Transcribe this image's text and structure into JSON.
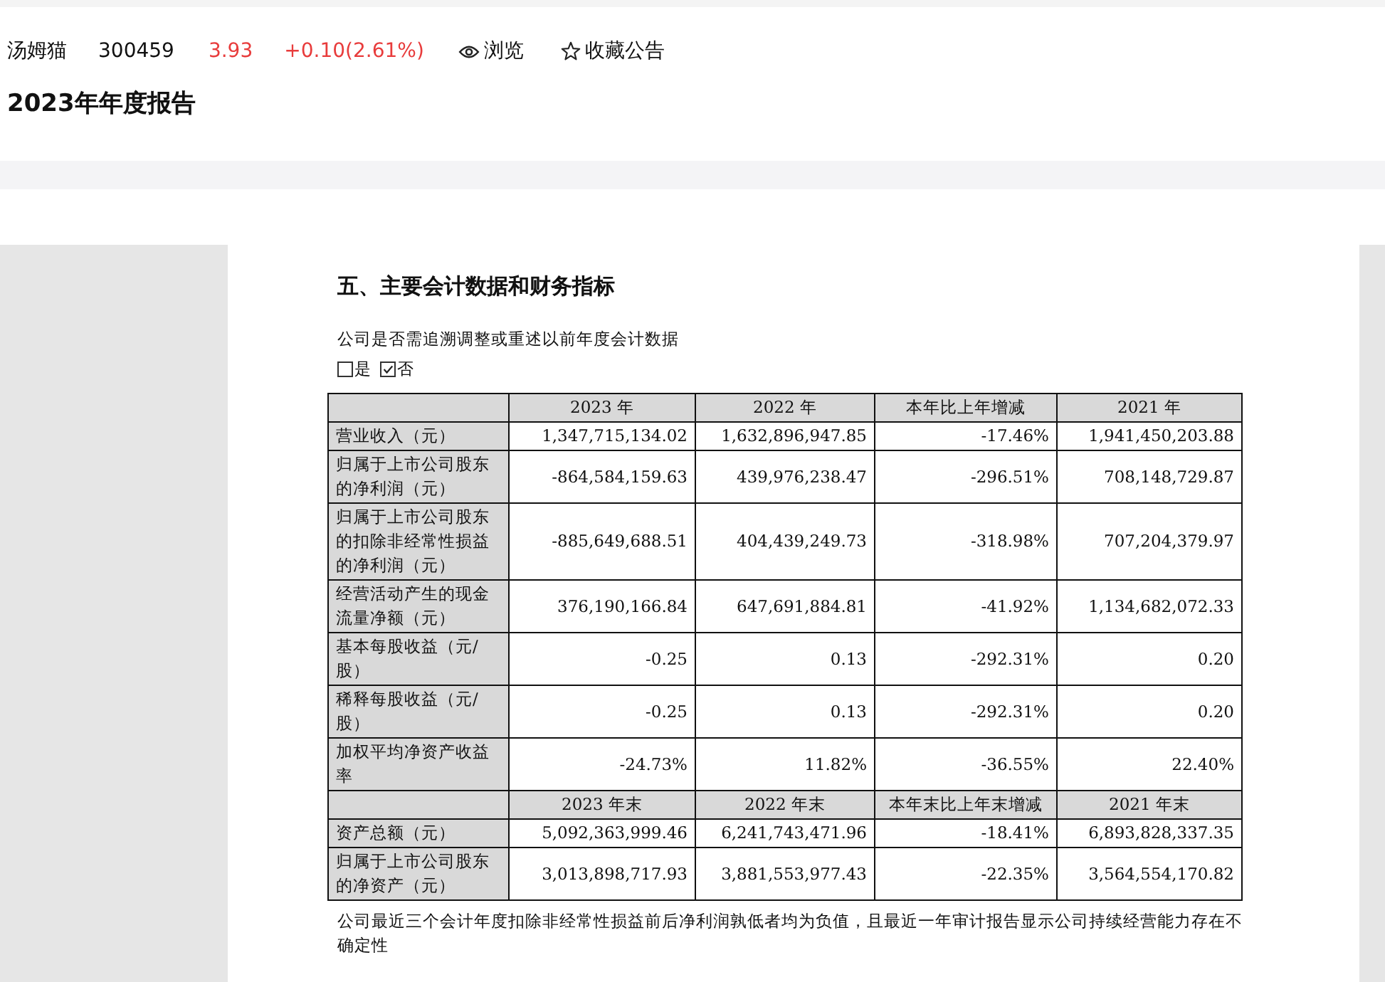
{
  "stock": {
    "name": "汤姆猫",
    "code": "300459",
    "price": "3.93",
    "change": "+0.10(2.61%)"
  },
  "actions": [
    {
      "kind": "view",
      "label": "浏览"
    },
    {
      "kind": "favorite",
      "label": "收藏公告"
    }
  ],
  "report_title": "2023年年度报告",
  "document": {
    "heading": "五、主要会计数据和财务指标",
    "question": "公司是否需追溯调整或重述以前年度会计数据",
    "options": [
      {
        "label": "是",
        "checked": false
      },
      {
        "label": "否",
        "checked": true
      }
    ],
    "table": {
      "sections": [
        {
          "columns": [
            "2023 年",
            "2022 年",
            "本年比上年增减",
            "2021 年"
          ],
          "rows": [
            {
              "label": "营业收入（元）",
              "cells": [
                "1,347,715,134.02",
                "1,632,896,947.85",
                "-17.46%",
                "1,941,450,203.88"
              ]
            },
            {
              "label": "归属于上市公司股东的净利润（元）",
              "cells": [
                "-864,584,159.63",
                "439,976,238.47",
                "-296.51%",
                "708,148,729.87"
              ]
            },
            {
              "label": "归属于上市公司股东的扣除非经常性损益的净利润（元）",
              "cells": [
                "-885,649,688.51",
                "404,439,249.73",
                "-318.98%",
                "707,204,379.97"
              ]
            },
            {
              "label": "经营活动产生的现金流量净额（元）",
              "cells": [
                "376,190,166.84",
                "647,691,884.81",
                "-41.92%",
                "1,134,682,072.33"
              ]
            },
            {
              "label": "基本每股收益（元/股）",
              "cells": [
                "-0.25",
                "0.13",
                "-292.31%",
                "0.20"
              ]
            },
            {
              "label": "稀释每股收益（元/股）",
              "cells": [
                "-0.25",
                "0.13",
                "-292.31%",
                "0.20"
              ]
            },
            {
              "label": "加权平均净资产收益率",
              "cells": [
                "-24.73%",
                "11.82%",
                "-36.55%",
                "22.40%"
              ]
            }
          ]
        },
        {
          "columns": [
            "2023 年末",
            "2022 年末",
            "本年末比上年末增减",
            "2021 年末"
          ],
          "rows": [
            {
              "label": "资产总额（元）",
              "cells": [
                "5,092,363,999.46",
                "6,241,743,471.96",
                "-18.41%",
                "6,893,828,337.35"
              ]
            },
            {
              "label": "归属于上市公司股东的净资产（元）",
              "cells": [
                "3,013,898,717.93",
                "3,881,553,977.43",
                "-22.35%",
                "3,564,554,170.82"
              ]
            }
          ]
        }
      ]
    },
    "note": "公司最近三个会计年度扣除非经常性损益前后净利润孰低者均为负值，且最近一年审计报告显示公司持续经营能力存在不确定性"
  }
}
